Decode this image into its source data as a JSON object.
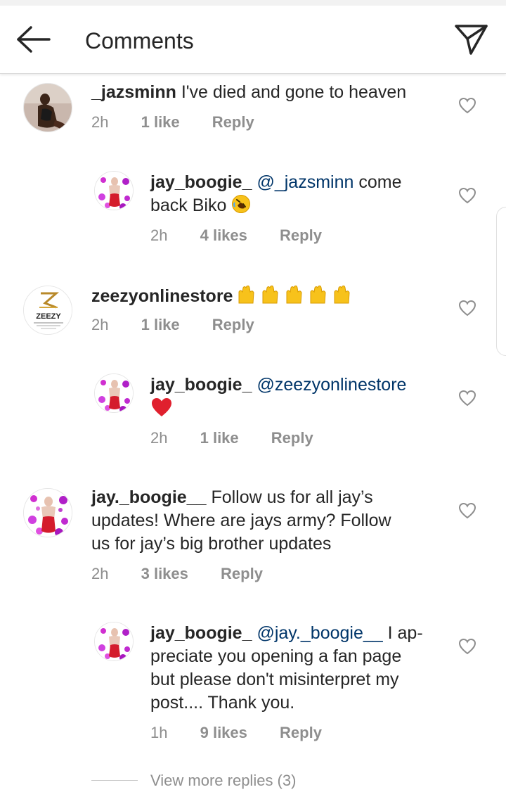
{
  "header": {
    "title": "Comments",
    "back_icon": "back-arrow-icon",
    "send_icon": "send-icon"
  },
  "comments": [
    {
      "username": "_jazsminn",
      "text": "I've died and gone to heaven",
      "time": "2h",
      "likes": "1 like",
      "reply": "Reply"
    },
    {
      "username": "jay_boogie_",
      "mention": "@_jazsminn",
      "text_line1": "come",
      "text_line2": "back Biko",
      "emoji": "rolling-on-floor-laughing-emoji",
      "time": "2h",
      "likes": "4 likes",
      "reply": "Reply"
    },
    {
      "username": "zeezyonlinestore",
      "emoji": "raising-hands-emoji x5",
      "time": "2h",
      "likes": "1 like",
      "reply": "Reply",
      "avatar_text": "ZEEZY"
    },
    {
      "username": "jay_boogie_",
      "mention": "@zeezyonlinestore",
      "emoji": "red-heart-emoji",
      "time": "2h",
      "likes": "1 like",
      "reply": "Reply"
    },
    {
      "username": "jay._boogie__",
      "text_line1": "Follow us for all jay’s",
      "text_line2": "updates! Where are jays army? Follow",
      "text_line3": "us for jay’s big brother updates",
      "time": "2h",
      "likes": "3 likes",
      "reply": "Reply"
    },
    {
      "username": "jay_boogie_",
      "mention": "@jay._boogie__",
      "text_line1": "I ap-",
      "text_line2": "preciate you opening a fan page",
      "text_line3": "but please don't misinterpret my",
      "text_line4": "post.... Thank you.",
      "time": "1h",
      "likes": "9 likes",
      "reply": "Reply"
    }
  ],
  "view_more": "View more replies (3)",
  "colors": {
    "text": "#262626",
    "meta": "#8e8e8e",
    "mention": "#003569",
    "heart_emoji": "#e0202e"
  }
}
